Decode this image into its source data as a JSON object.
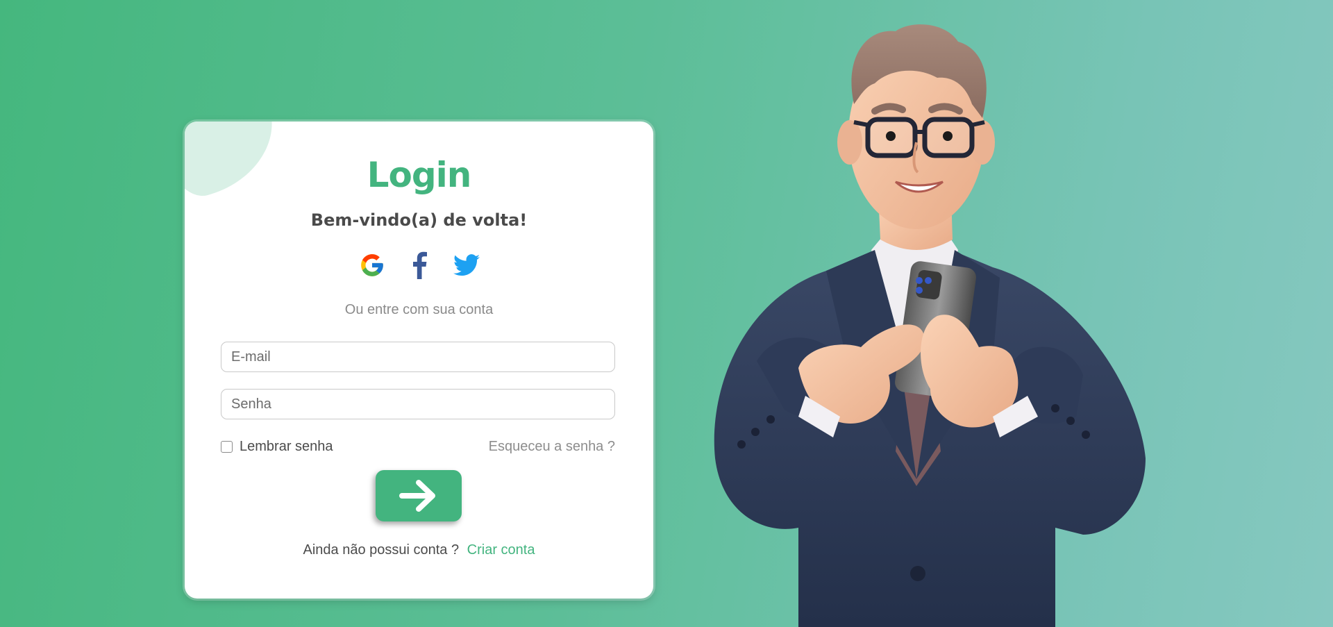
{
  "login": {
    "title": "Login",
    "subtitle": "Bem-vindo(a) de volta!",
    "social": [
      {
        "name": "google-icon"
      },
      {
        "name": "facebook-icon"
      },
      {
        "name": "twitter-icon"
      }
    ],
    "divider_text": "Ou entre com sua conta",
    "email_placeholder": "E-mail",
    "password_placeholder": "Senha",
    "remember_label": "Lembrar senha",
    "forgot_label": "Esqueceu a senha ?",
    "submit_icon": "arrow-right-icon",
    "signup_prompt": "Ainda não possui conta ?",
    "signup_link": "Criar conta"
  },
  "colors": {
    "accent": "#43b47f",
    "background_start": "#45b77e",
    "background_end": "#86c8c0"
  }
}
